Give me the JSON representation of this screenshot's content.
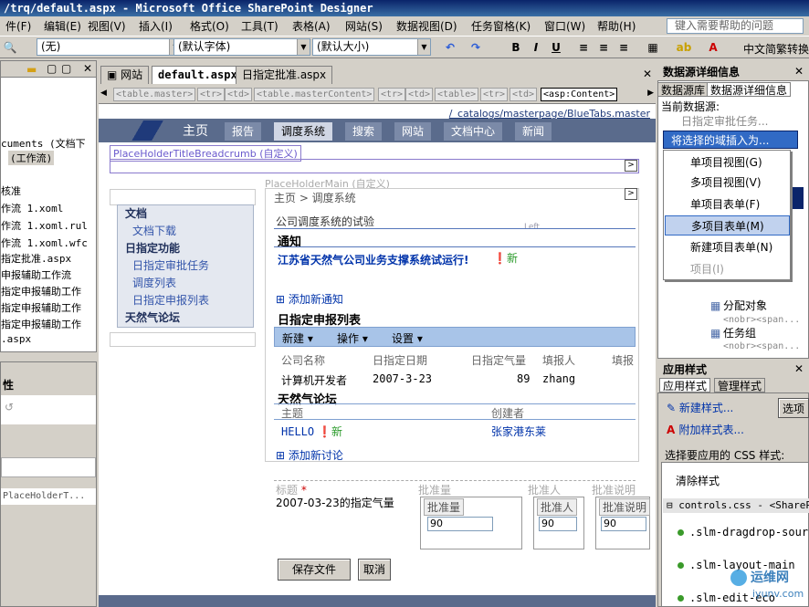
{
  "titlebar": "/trq/default.aspx - Microsoft Office SharePoint Designer",
  "menus": [
    "文件(F)",
    "编辑(E)",
    "视图(V)",
    "插入(I)",
    "格式(O)",
    "工具(T)",
    "表格(A)",
    "网站(S)",
    "数据视图(D)",
    "任务窗格(K)",
    "窗口(W)",
    "帮助(H)"
  ],
  "menu_visible": [
    "件(F)",
    "编辑(E)",
    "视图(V)",
    "插入(I)",
    "格式(O)",
    "工具(T)",
    "表格(A)",
    "网站(S)",
    "数据视图(D)",
    "任务窗格(K)",
    "窗口(W)",
    "帮助(H)"
  ],
  "help_placeholder": "键入需要帮助的问题",
  "toolbar": {
    "style": "(无)",
    "font": "(默认字体)",
    "size": "(默认大小)",
    "lang": "中文简繁转换"
  },
  "left_panel": {
    "items": [
      "cuments (文档下",
      "(工作流)",
      "核准",
      "作流 1.xoml",
      "作流 1.xoml.rul",
      "作流 1.xoml.wfc",
      "指定批准.aspx",
      "申报辅助工作流",
      "指定申报辅助工作",
      "指定申报辅助工作",
      "指定申报辅助工作",
      ".aspx"
    ],
    "prop_title": "性",
    "prop_item": "PlaceHolderT..."
  },
  "tabs": [
    "网站",
    "default.aspx",
    "日指定批准.aspx"
  ],
  "crumbs": [
    "<table.master>",
    "<tr>",
    "<td>",
    "<table.masterContent>",
    "<tr>",
    "<td>",
    "<table>",
    "<tr>",
    "<td>",
    "<asp:Content>"
  ],
  "canvas": {
    "master_path": "/_catalogs/masterpage/BlueTabs.master",
    "nav_tabs": [
      "主页",
      "报告",
      "调度系统",
      "搜索",
      "网站",
      "文档中心",
      "新闻"
    ],
    "ph_breadcrumb": "PlaceHolderTitleBreadcrumb (自定义)",
    "ph_main": "PlaceHolderMain (自定义)",
    "breadcrumb": "主页 > 调度系统",
    "page_desc": "公司调度系统的试验",
    "left_label": "Left",
    "leftnav": {
      "h1": "文档",
      "i1": "文档下载",
      "h2": "日指定功能",
      "i2": "日指定审批任务",
      "i3": "调度列表",
      "i4": "日指定申报列表",
      "h3": "天然气论坛"
    },
    "notice_title": "通知",
    "notice_item": "江苏省天然气公司业务支撑系统试运行!",
    "new_badge": "新",
    "add_notice": "添加新通知",
    "list_title": "日指定申报列表",
    "list_buttons": [
      "新建 ▾",
      "操作 ▾",
      "设置 ▾"
    ],
    "list_headers": [
      "公司名称",
      "日指定日期",
      "日指定气量",
      "填报人",
      "填报"
    ],
    "list_row": [
      "计算机开发者",
      "2007-3-23",
      "89",
      "zhang"
    ],
    "forum_title": "天然气论坛",
    "forum_headers": [
      "主题",
      "创建者"
    ],
    "forum_row": [
      "HELLO",
      "张家港东莱"
    ],
    "add_discussion": "添加新讨论",
    "form": {
      "title_label": "标题",
      "title_value": "2007-03-23的指定气量",
      "qty_label": "批准量",
      "person_label": "批准人",
      "note_label": "批准说明",
      "qty_inner": "批准量",
      "person_inner": "批准人",
      "note_inner": "批准说明",
      "v1": "90",
      "v2": "90",
      "v3": "90",
      "save": "保存文件",
      "cancel": "取消"
    }
  },
  "right_panel": {
    "title": "数据源详细信息",
    "tabs": [
      "数据源库",
      "数据源详细信息"
    ],
    "current_label": "当前数据源:",
    "current_value": "日指定审批任务...",
    "insert_btn": "将选择的域插入为...",
    "menu": [
      "单项目视图(G)",
      "多项目视图(V)",
      "单项目表单(F)",
      "多项目表单(M)",
      "新建项目表单(N)",
      "项目(I)"
    ],
    "tree": [
      "分配对象",
      "<nobr><span...",
      "任务组",
      "<nobr><span..."
    ],
    "styles_title": "应用样式",
    "styles_tabs": [
      "应用样式",
      "管理样式"
    ],
    "new_style": "新建样式...",
    "attach_style": "附加样式表...",
    "options_btn": "选项",
    "choose_label": "选择要应用的 CSS 样式:",
    "clear_style": "清除样式",
    "css_file": "controls.css - <SharePoi",
    "css_items": [
      ".slm-dragdrop-source",
      ".slm-layout-main",
      ".slm-edit-eco"
    ]
  },
  "watermark": {
    "text": "运维网",
    "url": "iyunv.com"
  },
  "colors": {
    "titlebar": "#0a246a",
    "nav": "#5a6b8c",
    "link": "#0033aa",
    "highlight": "#c1d2ee"
  }
}
